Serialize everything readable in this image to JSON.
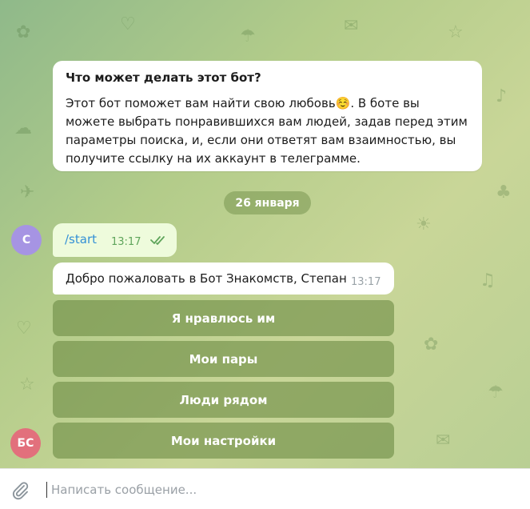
{
  "bot_info": {
    "title": "Что может делать этот бот?",
    "description": "Этот бот поможет вам найти свою любовь☺️. В боте вы можете выбрать понравившихся вам людей, задав перед этим параметры поиска, и, если они ответят вам взаимностью, вы получите ссылку на их аккаунт в телеграмме."
  },
  "date_separator": "26 января",
  "messages": [
    {
      "avatar": "С",
      "avatar_color": "#a694e3",
      "text": "/start",
      "time": "13:17",
      "status": "read"
    },
    {
      "avatar": "БС",
      "avatar_color": "#e2707c",
      "text": "Добро пожаловать в Бот Знакомств, Степан",
      "time": "13:17"
    }
  ],
  "keyboard": [
    {
      "label": "Я нравлюсь им"
    },
    {
      "label": "Мои пары"
    },
    {
      "label": "Люди рядом"
    },
    {
      "label": "Мои настройки"
    }
  ],
  "composer": {
    "placeholder": "Написать сообщение...",
    "value": ""
  },
  "colors": {
    "outgoing_bubble": "#eefbdc",
    "link": "#3390d6",
    "read_check": "#5fa55b",
    "keyboard_button": "#7f9a57"
  },
  "icons": [
    "paperclip-icon",
    "double-check-icon"
  ]
}
